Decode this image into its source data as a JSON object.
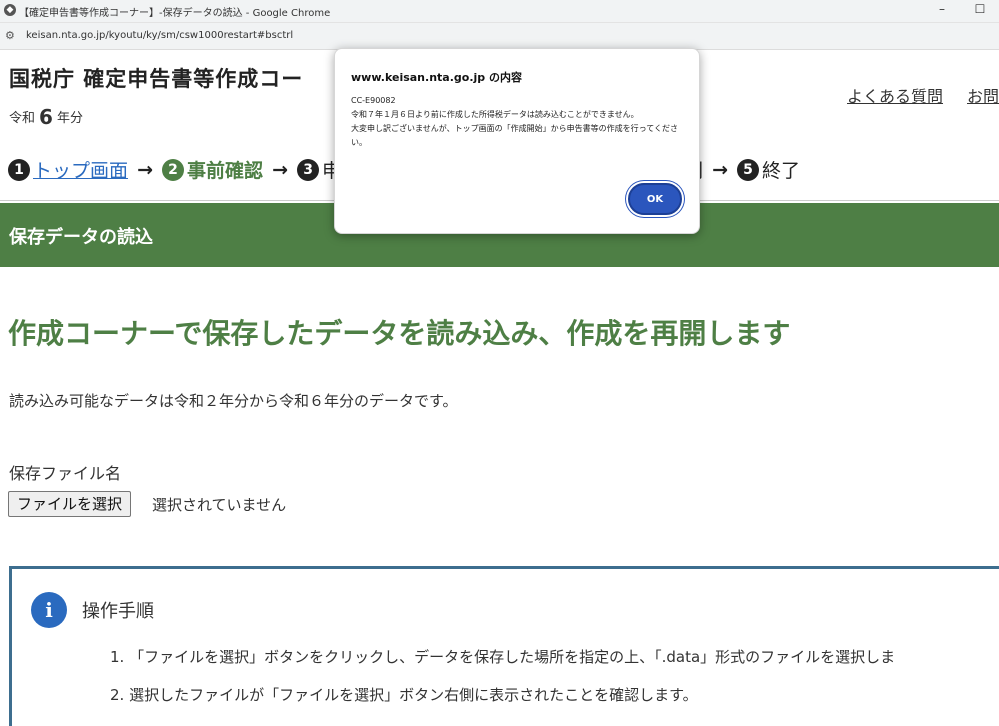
{
  "browser": {
    "window_title": "【確定申告書等作成コーナー】-保存データの読込 - Google Chrome",
    "url": "keisan.nta.go.jp/kyoutu/ky/sm/csw1000restart#bsctrl",
    "minimize_glyph": "–",
    "maximize_glyph": "☐"
  },
  "header": {
    "site_title": "国税庁 確定申告書等作成コー",
    "era_prefix": "令和",
    "era_number": "6",
    "era_suffix": "年分",
    "links": [
      "よくある質問",
      "お問"
    ]
  },
  "steps": {
    "items": [
      {
        "num": "1",
        "label": "トップ画面",
        "state": "link"
      },
      {
        "num": "2",
        "label": "事前確認",
        "state": "current"
      },
      {
        "num": "3",
        "label": "申",
        "state": "pending"
      }
    ],
    "tail_text": "刷",
    "last": {
      "num": "5",
      "label": "終了"
    }
  },
  "section": {
    "title": "保存データの読込"
  },
  "main": {
    "headline": "作成コーナーで保存したデータを読み込み、作成を再開します",
    "description": "読み込み可能なデータは令和２年分から令和６年分のデータです。",
    "file_label": "保存ファイル名",
    "file_button": "ファイルを選択",
    "file_status": "選択されていません"
  },
  "info": {
    "title": "操作手順",
    "steps": [
      "1. 「ファイルを選択」ボタンをクリックし、データを保存した場所を指定の上、「.data」形式のファイルを選択しま",
      "2. 選択したファイルが「ファイルを選択」ボタン右側に表示されたことを確認します。"
    ]
  },
  "dialog": {
    "title": "www.keisan.nta.go.jp の内容",
    "message": "CC-E90082\n 令和７年１月６日より前に作成した所得税データは読み込むことができません。\n大変申し訳ございませんが、トップ画面の「作成開始」から申告書等の作成を行ってください。",
    "ok_label": "OK"
  },
  "colors": {
    "brand_green": "#4e7f45",
    "link_blue": "#2a6abf",
    "info_border": "#3d6e8f",
    "ok_button": "#2b56bd"
  }
}
